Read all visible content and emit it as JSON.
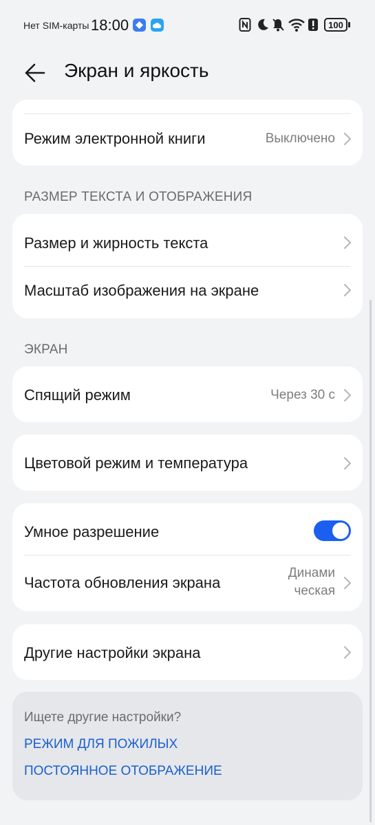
{
  "status_bar": {
    "carrier": "Нет SIM-карты",
    "time": "18:00",
    "battery": "100"
  },
  "header": {
    "title": "Экран и яркость"
  },
  "card_ebook": {
    "label": "Режим электронной книги",
    "value": "Выключено"
  },
  "section_text_size": {
    "label": "РАЗМЕР ТЕКСТА И ОТОБРАЖЕНИЯ",
    "items": [
      {
        "label": "Размер и жирность текста"
      },
      {
        "label": "Масштаб изображения на экране"
      }
    ]
  },
  "section_screen": {
    "label": "ЭКРАН",
    "sleep": {
      "label": "Спящий режим",
      "value": "Через 30 с"
    },
    "color": {
      "label": "Цветовой режим и температура"
    },
    "smart_resolution": {
      "label": "Умное разрешение",
      "enabled": true
    },
    "refresh_rate": {
      "label": "Частота обновления экрана",
      "value_line1": "Динами",
      "value_line2": "ческая"
    },
    "other": {
      "label": "Другие настройки экрана"
    }
  },
  "suggestions": {
    "title": "Ищете другие настройки?",
    "links": [
      "РЕЖИМ ДЛЯ ПОЖИЛЫХ",
      "ПОСТОЯННОЕ ОТОБРАЖЕНИЕ"
    ]
  },
  "colors": {
    "accent": "#1a5ff0",
    "link": "#1a5fd0",
    "background": "#f1f3f5"
  }
}
